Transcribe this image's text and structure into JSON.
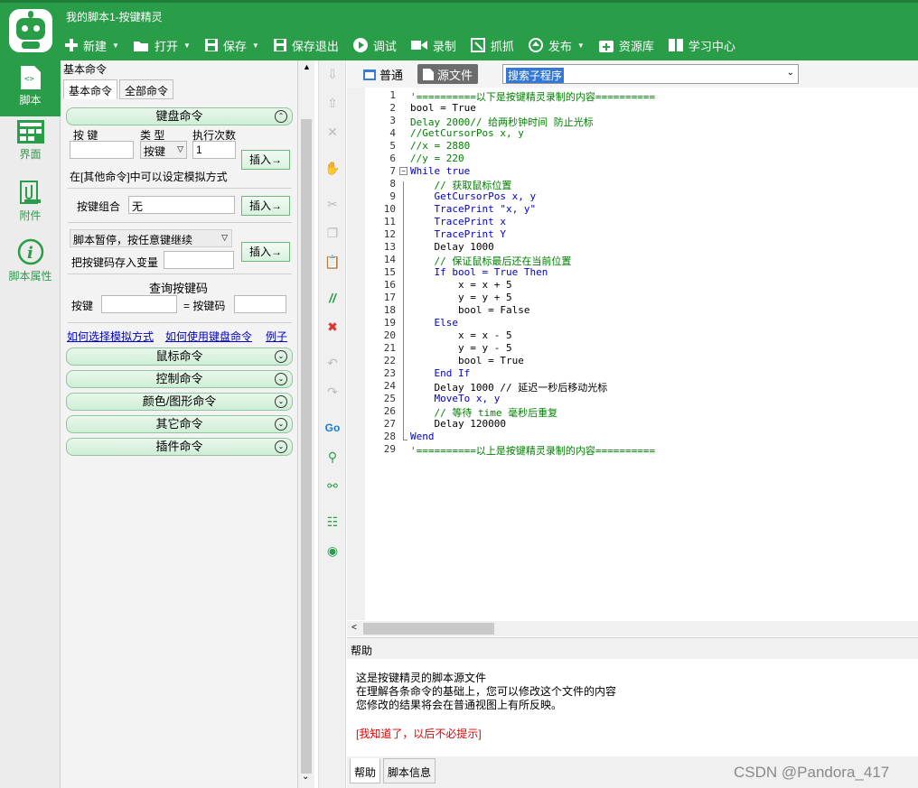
{
  "window": {
    "title": "我的脚本1-按键精灵"
  },
  "toolbar": [
    {
      "label": "新建",
      "icon": "plus-icon",
      "dropdown": true
    },
    {
      "label": "打开",
      "icon": "folder-icon",
      "dropdown": true
    },
    {
      "label": "保存",
      "icon": "save-icon",
      "dropdown": true
    },
    {
      "label": "保存退出",
      "icon": "save-exit-icon",
      "dropdown": false
    },
    {
      "label": "调试",
      "icon": "play-icon",
      "dropdown": false
    },
    {
      "label": "录制",
      "icon": "record-icon",
      "dropdown": false
    },
    {
      "label": "抓抓",
      "icon": "grab-icon",
      "dropdown": false
    },
    {
      "label": "发布",
      "icon": "publish-icon",
      "dropdown": true
    },
    {
      "label": "资源库",
      "icon": "resource-icon",
      "dropdown": false
    },
    {
      "label": "学习中心",
      "icon": "learn-icon",
      "dropdown": false
    }
  ],
  "leftnav": [
    {
      "label": "脚本",
      "icon": "script-icon",
      "active": true
    },
    {
      "label": "界面",
      "icon": "layout-icon",
      "active": false
    },
    {
      "label": "附件",
      "icon": "attachment-icon",
      "active": false
    },
    {
      "label": "脚本属性",
      "icon": "info-icon",
      "active": false
    }
  ],
  "cmdpanel": {
    "title": "基本命令",
    "tabs": [
      "基本命令",
      "全部命令"
    ],
    "keyboard": {
      "section": "键盘命令",
      "col_key": "按 键",
      "col_type": "类 型",
      "col_times": "执行次数",
      "type_value": "按键",
      "times_value": "1",
      "insert": "插入→",
      "hint": "在[其他命令]中可以设定模拟方式",
      "combo_label": "按键组合",
      "combo_value": "无",
      "pause_value": "脚本暂停，按任意键继续",
      "save_var_label": "把按键码存入变量",
      "query_title": "查询按键码",
      "query_key": "按键",
      "query_code": "= 按键码"
    },
    "links": [
      "如何选择模拟方式",
      "如何使用键盘命令",
      "例子"
    ],
    "sections": [
      "鼠标命令",
      "控制命令",
      "颜色/图形命令",
      "其它命令",
      "插件命令"
    ]
  },
  "editor": {
    "mode_normal": "普通",
    "mode_source": "源文件",
    "subroutine_search": "搜索子程序",
    "lines": [
      {
        "n": "1",
        "text": "'==========以下是按键精灵录制的内容=========="
      },
      {
        "n": "2",
        "text": "bool = True"
      },
      {
        "n": "3",
        "text": "Delay 2000// 给两秒钟时间 防止光标"
      },
      {
        "n": "4",
        "text": "//GetCursorPos x, y"
      },
      {
        "n": "5",
        "text": "//x = 2880"
      },
      {
        "n": "6",
        "text": "//y = 220"
      },
      {
        "n": "7",
        "text": "While true"
      },
      {
        "n": "8",
        "text": "    // 获取鼠标位置"
      },
      {
        "n": "9",
        "text": "    GetCursorPos x, y"
      },
      {
        "n": "10",
        "text": "    TracePrint \"x, y\""
      },
      {
        "n": "11",
        "text": "    TracePrint x"
      },
      {
        "n": "12",
        "text": "    TracePrint Y"
      },
      {
        "n": "13",
        "text": "    Delay 1000"
      },
      {
        "n": "14",
        "text": "    // 保证鼠标最后还在当前位置"
      },
      {
        "n": "15",
        "text": "    If bool = True Then"
      },
      {
        "n": "16",
        "text": "        x = x + 5"
      },
      {
        "n": "17",
        "text": "        y = y + 5"
      },
      {
        "n": "18",
        "text": "        bool = False"
      },
      {
        "n": "19",
        "text": "    Else"
      },
      {
        "n": "20",
        "text": "        x = x - 5"
      },
      {
        "n": "21",
        "text": "        y = y - 5"
      },
      {
        "n": "22",
        "text": "        bool = True"
      },
      {
        "n": "23",
        "text": "    End If"
      },
      {
        "n": "24",
        "text": "    Delay 1000 // 延迟一秒后移动光标"
      },
      {
        "n": "25",
        "text": "    MoveTo x, y"
      },
      {
        "n": "26",
        "text": "    // 等待 time 毫秒后重复"
      },
      {
        "n": "27",
        "text": "    Delay 120000"
      },
      {
        "n": "28",
        "text": "Wend"
      },
      {
        "n": "29",
        "text": "'==========以上是按键精灵录制的内容=========="
      }
    ]
  },
  "help": {
    "title": "帮助",
    "text1": "这是按键精灵的脚本源文件",
    "text2": "在理解各条命令的基础上，您可以修改这个文件的内容",
    "text3": "您修改的结果将会在普通视图上有所反映。",
    "dismiss": "[我知道了，以后不必提示]",
    "tabs": [
      "帮助",
      "脚本信息"
    ]
  },
  "watermark": "CSDN @Pandora_417",
  "colors": {
    "brand_green": "#2a9d48",
    "keyword_blue": "#0000cc",
    "comment_green": "#008000",
    "link_red": "#e00000"
  }
}
